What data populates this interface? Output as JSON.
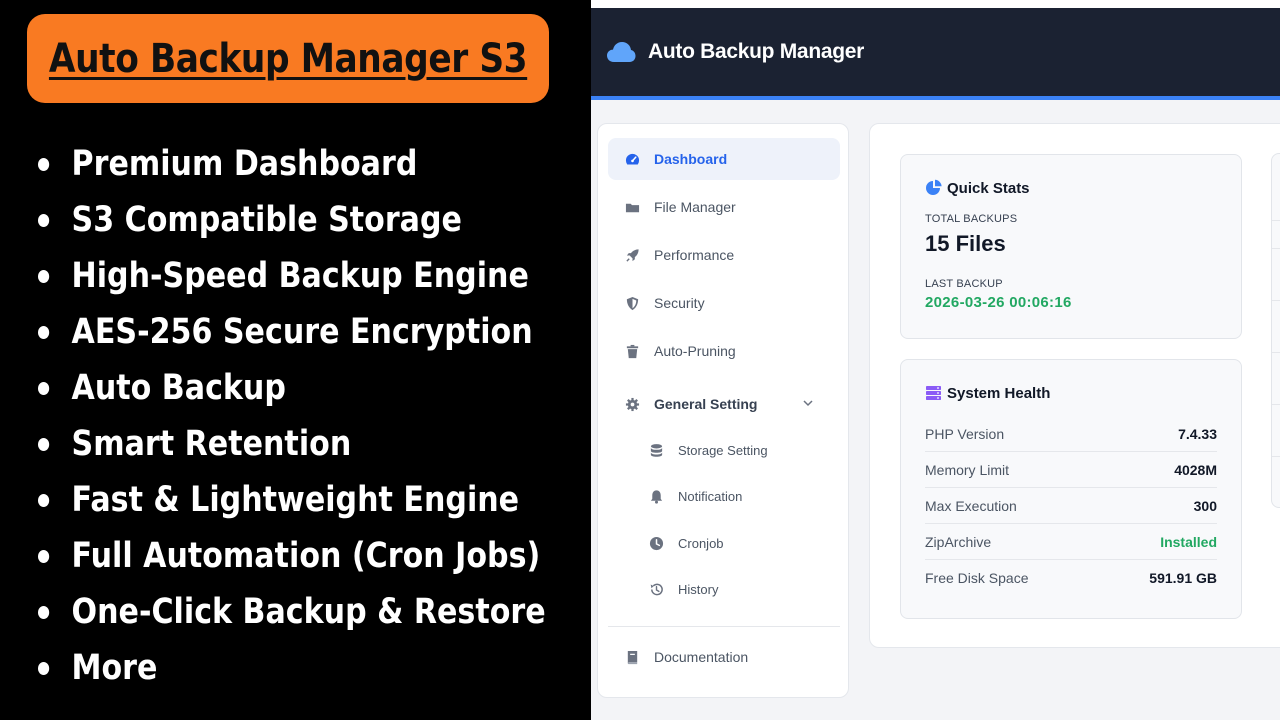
{
  "promo": {
    "title": "Auto Backup Manager S3",
    "features": [
      "Premium Dashboard",
      "S3 Compatible Storage",
      "High-Speed Backup Engine",
      "AES-256 Secure Encryption",
      "Auto Backup",
      "Smart Retention",
      "Fast & Lightweight Engine",
      "Full Automation (Cron Jobs)",
      "One-Click Backup & Restore",
      "More"
    ],
    "accent_color": "#f97a22"
  },
  "app": {
    "brand": {
      "name": "Auto Backup Manager",
      "icon": "cloud-icon"
    },
    "colors": {
      "topbar": "#1b2232",
      "accent": "#3b82f6",
      "active": "#2563eb",
      "success": "#22a862"
    },
    "sidebar": {
      "items": [
        {
          "label": "Dashboard",
          "icon": "gauge-icon"
        },
        {
          "label": "File Manager",
          "icon": "folder-icon"
        },
        {
          "label": "Performance",
          "icon": "rocket-icon"
        },
        {
          "label": "Security",
          "icon": "shield-icon"
        },
        {
          "label": "Auto-Pruning",
          "icon": "trash-icon"
        },
        {
          "label": "General Setting",
          "icon": "gear-icon"
        },
        {
          "label": "Storage Setting",
          "icon": "database-icon"
        },
        {
          "label": "Notification",
          "icon": "bell-icon"
        },
        {
          "label": "Cronjob",
          "icon": "clock-icon"
        },
        {
          "label": "History",
          "icon": "history-icon"
        },
        {
          "label": "Documentation",
          "icon": "book-icon"
        }
      ]
    },
    "quick_stats": {
      "title": "Quick Stats",
      "total_backups_label": "TOTAL BACKUPS",
      "total_backups_value": "15 Files",
      "last_backup_label": "LAST BACKUP",
      "last_backup_value": "2026-03-26 00:06:16"
    },
    "system_health": {
      "title": "System Health",
      "rows": [
        {
          "key": "PHP Version",
          "value": "7.4.33"
        },
        {
          "key": "Memory Limit",
          "value": "4028M"
        },
        {
          "key": "Max Execution",
          "value": "300"
        },
        {
          "key": "ZipArchive",
          "value": "Installed"
        },
        {
          "key": "Free Disk Space",
          "value": "591.91 GB"
        }
      ]
    }
  }
}
